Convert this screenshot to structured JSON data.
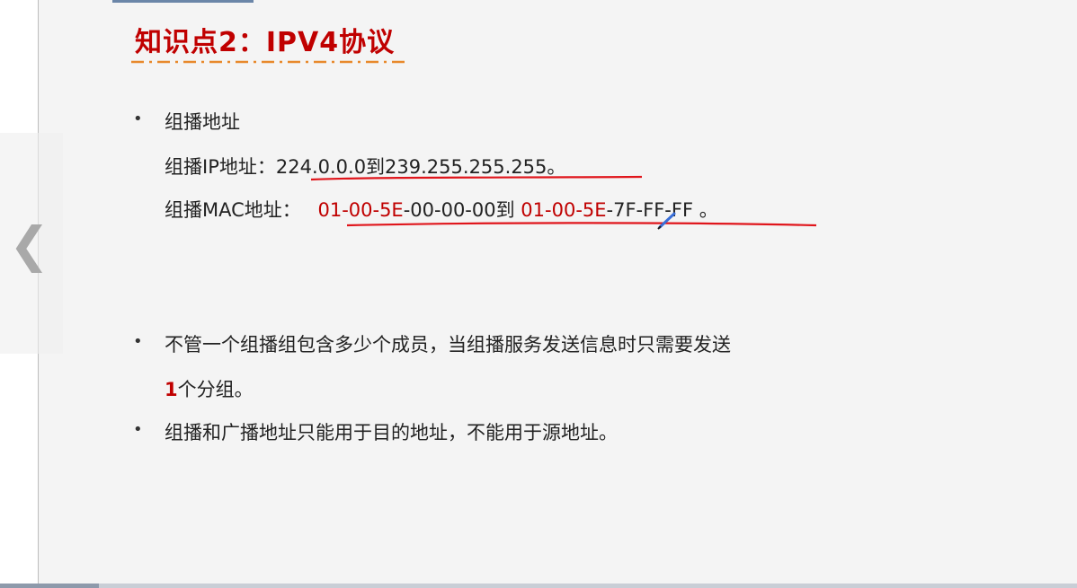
{
  "nav": {
    "prev_glyph": "❮"
  },
  "slide": {
    "title": "知识点2：IPV4协议",
    "section1": {
      "heading": "组播地址",
      "ip_label": "组播IP地址：",
      "ip_range": "224.0.0.0到239.255.255.255",
      "ip_end": "。",
      "mac_label": "组播MAC地址：",
      "mac_a_red": "01-00-5E",
      "mac_a_rest": "-00-00-00到",
      "mac_b_red": "01-00-5E",
      "mac_b_rest": "-7F-FF-FF",
      "mac_end": "。"
    },
    "section2": {
      "line1": "不管一个组播组包含多少个成员，当组播服务发送信息时只需要发送",
      "line2_num": "1",
      "line2_rest": "个分组。"
    },
    "section3": {
      "line": "组播和广播地址只能用于目的地址，不能用于源地址。"
    }
  },
  "colors": {
    "accent_red": "#c00000",
    "underline_orange": "#e8892c",
    "annotation_blue": "#3a6fd8"
  }
}
